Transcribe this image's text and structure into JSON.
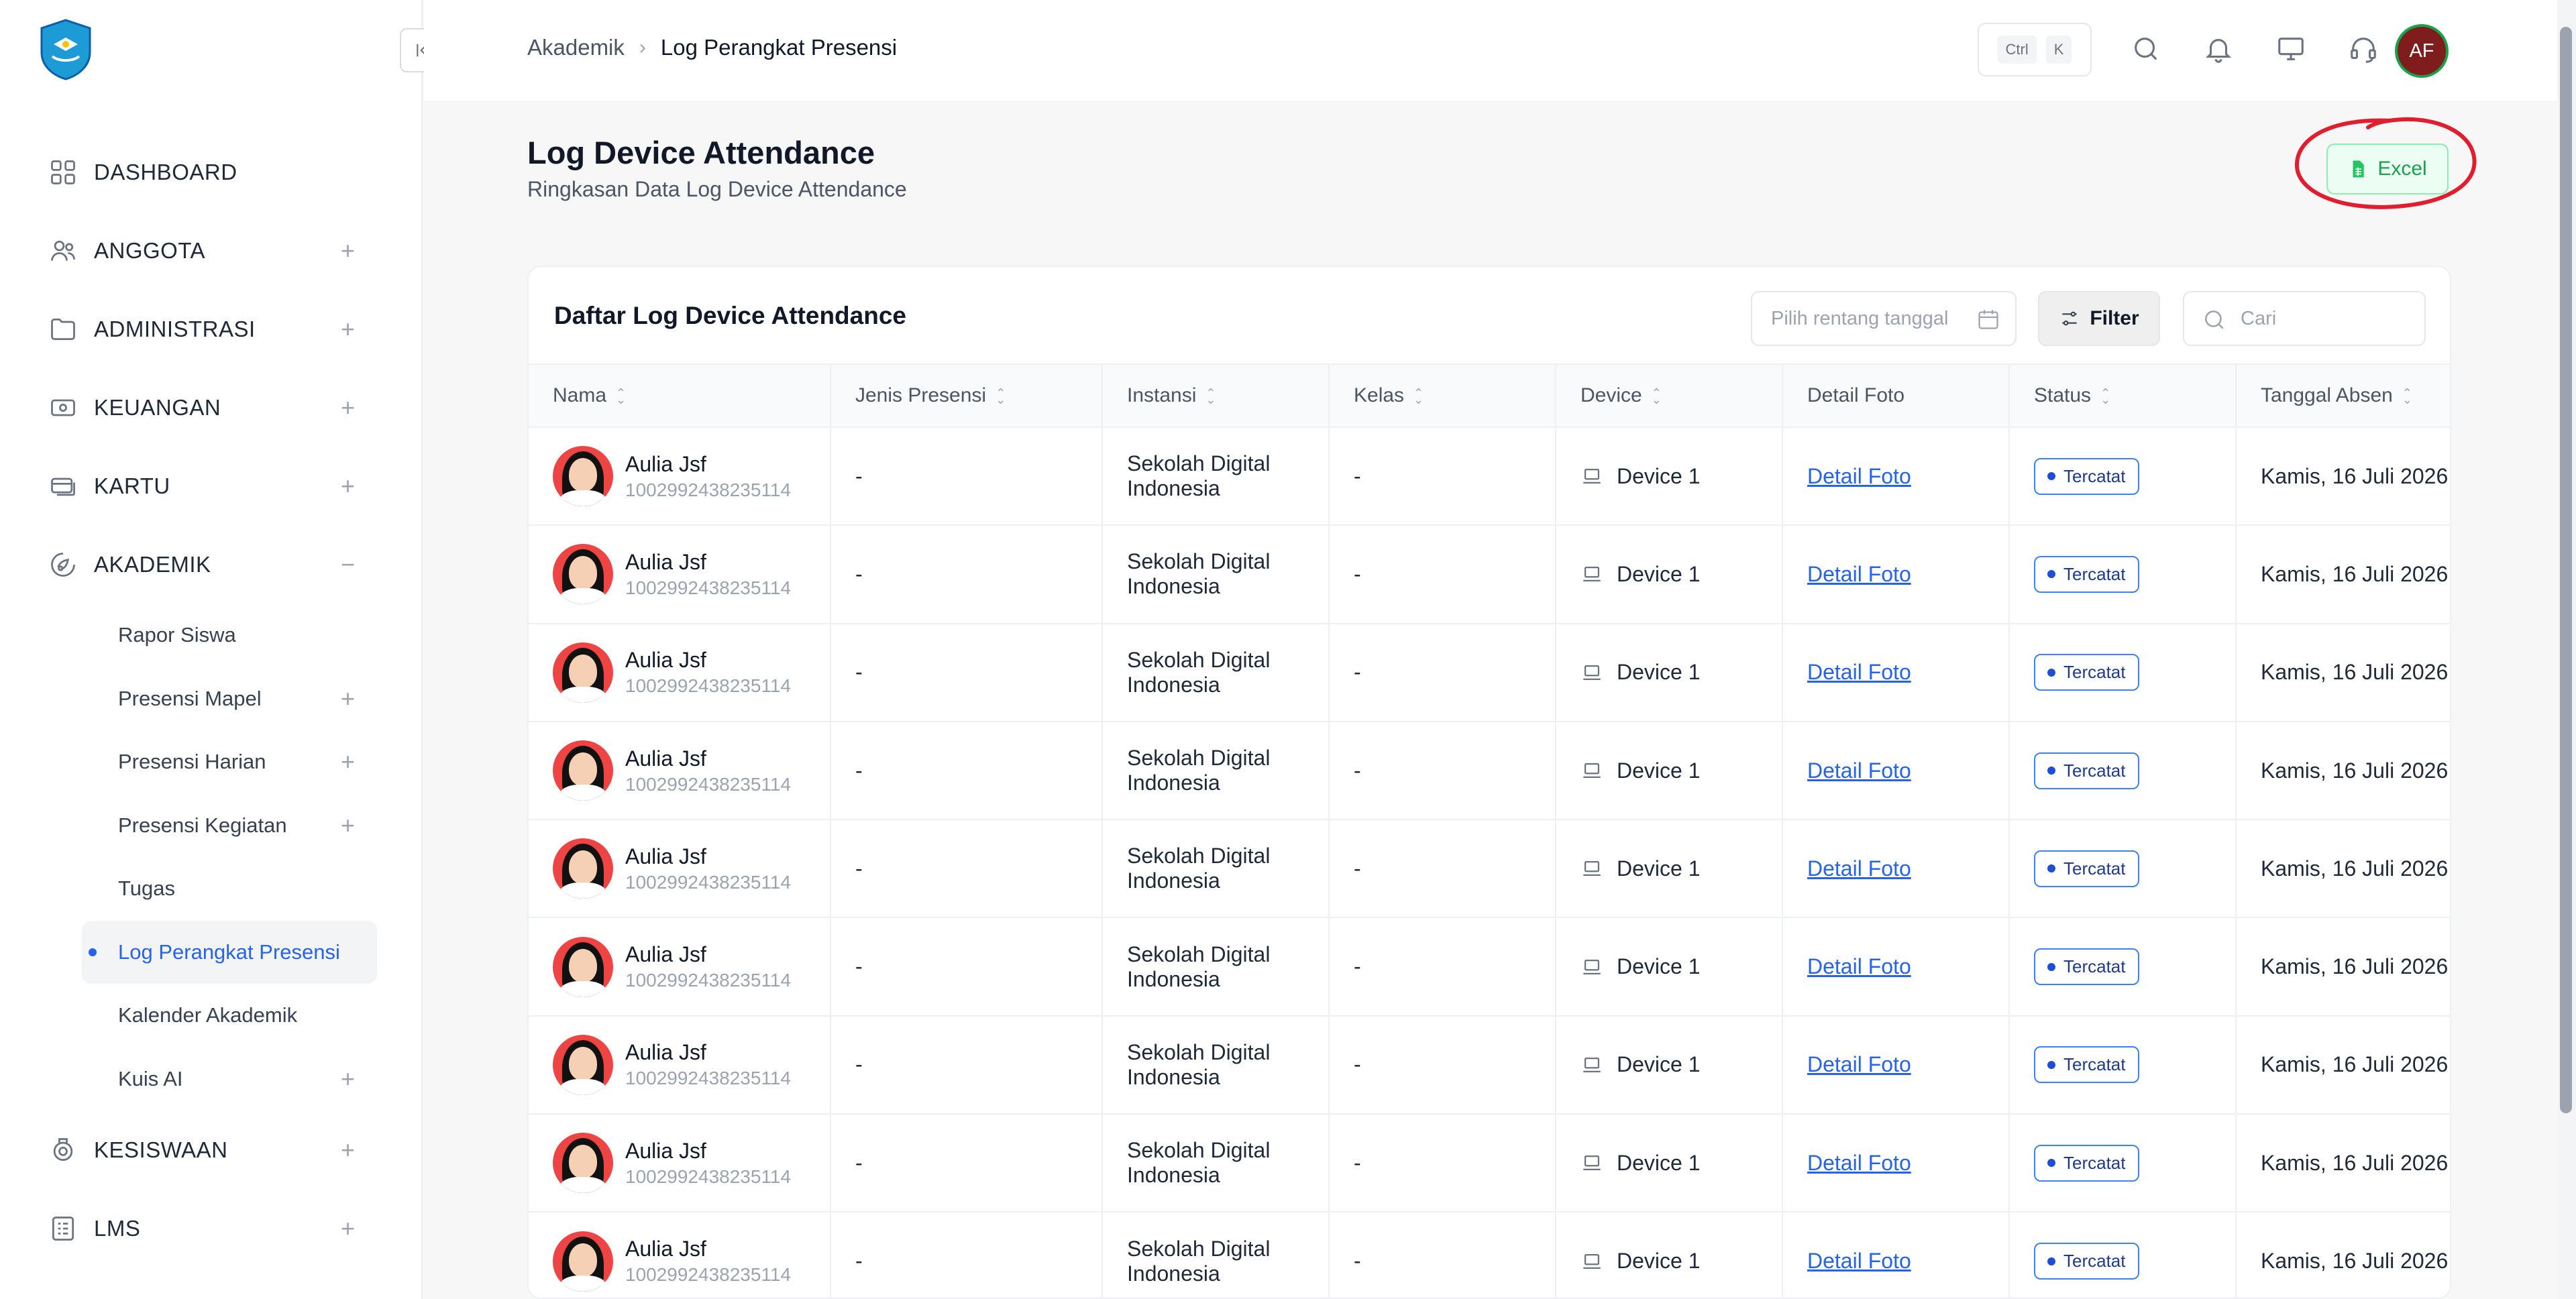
{
  "sidebar": {
    "items": [
      {
        "label": "DASHBOARD",
        "icon": "grid-icon",
        "expandable": false
      },
      {
        "label": "ANGGOTA",
        "icon": "users-icon",
        "expandable": true
      },
      {
        "label": "ADMINISTRASI",
        "icon": "folder-icon",
        "expandable": true
      },
      {
        "label": "KEUANGAN",
        "icon": "money-icon",
        "expandable": true
      },
      {
        "label": "KARTU",
        "icon": "card-icon",
        "expandable": true
      },
      {
        "label": "AKADEMIK",
        "icon": "academic-icon",
        "expandable": true,
        "expanded": true
      }
    ],
    "akademik_sub": [
      {
        "label": "Rapor Siswa"
      },
      {
        "label": "Presensi Mapel"
      },
      {
        "label": "Presensi Harian"
      },
      {
        "label": "Presensi Kegiatan"
      },
      {
        "label": "Tugas"
      },
      {
        "label": "Log Perangkat Presensi",
        "active": true
      },
      {
        "label": "Kalender Akademik"
      },
      {
        "label": "Kuis AI"
      }
    ],
    "bottom_items": [
      {
        "label": "KESISWAAN",
        "icon": "student-icon"
      },
      {
        "label": "LMS",
        "icon": "checklist-icon"
      }
    ],
    "plus": "+",
    "minus": "−"
  },
  "topbar": {
    "breadcrumb": [
      "Akademik",
      "Log Perangkat Presensi"
    ],
    "kbd": [
      "Ctrl",
      "K"
    ],
    "avatar_initials": "AF"
  },
  "page": {
    "title": "Log Device Attendance",
    "subtitle": "Ringkasan Data Log Device Attendance",
    "excel_label": "Excel"
  },
  "card": {
    "title": "Daftar Log Device Attendance",
    "date_placeholder": "Pilih rentang tanggal",
    "filter_label": "Filter",
    "search_placeholder": "Cari"
  },
  "table": {
    "columns": [
      "Nama",
      "Jenis Presensi",
      "Instansi",
      "Kelas",
      "Device",
      "Detail Foto",
      "Status",
      "Tanggal Absen"
    ],
    "rows": [
      {
        "name": "Aulia Jsf",
        "id": "1002992438235114",
        "jenis": "-",
        "instansi": "Sekolah Digital Indonesia",
        "kelas": "-",
        "device": "Device 1",
        "foto": "Detail Foto",
        "status": "Tercatat",
        "tanggal": "Kamis, 16 Juli 2026"
      },
      {
        "name": "Aulia Jsf",
        "id": "1002992438235114",
        "jenis": "-",
        "instansi": "Sekolah Digital Indonesia",
        "kelas": "-",
        "device": "Device 1",
        "foto": "Detail Foto",
        "status": "Tercatat",
        "tanggal": "Kamis, 16 Juli 2026"
      },
      {
        "name": "Aulia Jsf",
        "id": "1002992438235114",
        "jenis": "-",
        "instansi": "Sekolah Digital Indonesia",
        "kelas": "-",
        "device": "Device 1",
        "foto": "Detail Foto",
        "status": "Tercatat",
        "tanggal": "Kamis, 16 Juli 2026"
      },
      {
        "name": "Aulia Jsf",
        "id": "1002992438235114",
        "jenis": "-",
        "instansi": "Sekolah Digital Indonesia",
        "kelas": "-",
        "device": "Device 1",
        "foto": "Detail Foto",
        "status": "Tercatat",
        "tanggal": "Kamis, 16 Juli 2026"
      },
      {
        "name": "Aulia Jsf",
        "id": "1002992438235114",
        "jenis": "-",
        "instansi": "Sekolah Digital Indonesia",
        "kelas": "-",
        "device": "Device 1",
        "foto": "Detail Foto",
        "status": "Tercatat",
        "tanggal": "Kamis, 16 Juli 2026"
      },
      {
        "name": "Aulia Jsf",
        "id": "1002992438235114",
        "jenis": "-",
        "instansi": "Sekolah Digital Indonesia",
        "kelas": "-",
        "device": "Device 1",
        "foto": "Detail Foto",
        "status": "Tercatat",
        "tanggal": "Kamis, 16 Juli 2026"
      },
      {
        "name": "Aulia Jsf",
        "id": "1002992438235114",
        "jenis": "-",
        "instansi": "Sekolah Digital Indonesia",
        "kelas": "-",
        "device": "Device 1",
        "foto": "Detail Foto",
        "status": "Tercatat",
        "tanggal": "Kamis, 16 Juli 2026"
      },
      {
        "name": "Aulia Jsf",
        "id": "1002992438235114",
        "jenis": "-",
        "instansi": "Sekolah Digital Indonesia",
        "kelas": "-",
        "device": "Device 1",
        "foto": "Detail Foto",
        "status": "Tercatat",
        "tanggal": "Kamis, 16 Juli 2026"
      },
      {
        "name": "Aulia Jsf",
        "id": "1002992438235114",
        "jenis": "-",
        "instansi": "Sekolah Digital Indonesia",
        "kelas": "-",
        "device": "Device 1",
        "foto": "Detail Foto",
        "status": "Tercatat",
        "tanggal": "Kamis, 16 Juli 2026"
      }
    ]
  },
  "colors": {
    "accent": "#2563eb",
    "excel_green": "#16a34a",
    "annotation_red": "#e11d2e"
  }
}
